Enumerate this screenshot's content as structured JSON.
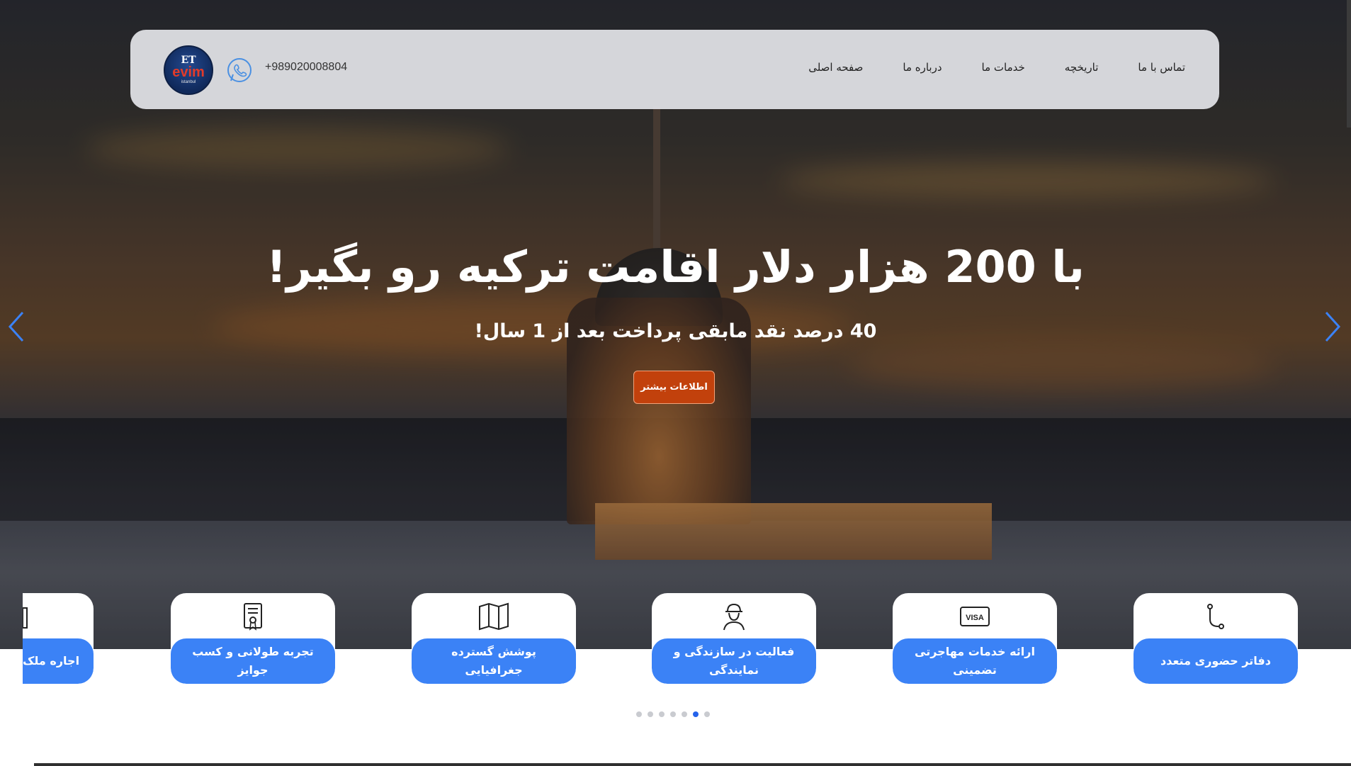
{
  "nav": {
    "logo": {
      "top_text": "ET",
      "main_text": "evim",
      "sub_text": "istanbul"
    },
    "phone": "+989020008804",
    "menu": [
      "صفحه اصلی",
      "درباره ما",
      "خدمات ما",
      "تاریخچه",
      "تماس با ما"
    ]
  },
  "hero": {
    "title": "با 200 هزار دلار اقامت ترکیه رو بگیر!",
    "subtitle": "40 درصد نقد مابقی پرداخت بعد از 1 سال!",
    "cta_label": "اطلاعات بیشتر"
  },
  "features": [
    {
      "label": "دفاتر حضوری متعدد",
      "icon": "branch-icon"
    },
    {
      "label": "ارائه خدمات مهاجرتی تضمینی",
      "icon": "visa-icon"
    },
    {
      "label": "فعالیت در سازندگی و نمایندگی",
      "icon": "worker-icon"
    },
    {
      "label": "پوشش گسترده جغرافیایی",
      "icon": "map-icon"
    },
    {
      "label": "تجربه طولانی و کسب جوایز",
      "icon": "certificate-icon"
    },
    {
      "label": "اجاره ملک",
      "icon": "building-icon"
    }
  ],
  "carousel": {
    "dots": 7,
    "active_index": 5
  },
  "colors": {
    "accent_blue": "#3b82f6",
    "cta_orange": "#c2410c",
    "active_dot": "#2563eb"
  }
}
